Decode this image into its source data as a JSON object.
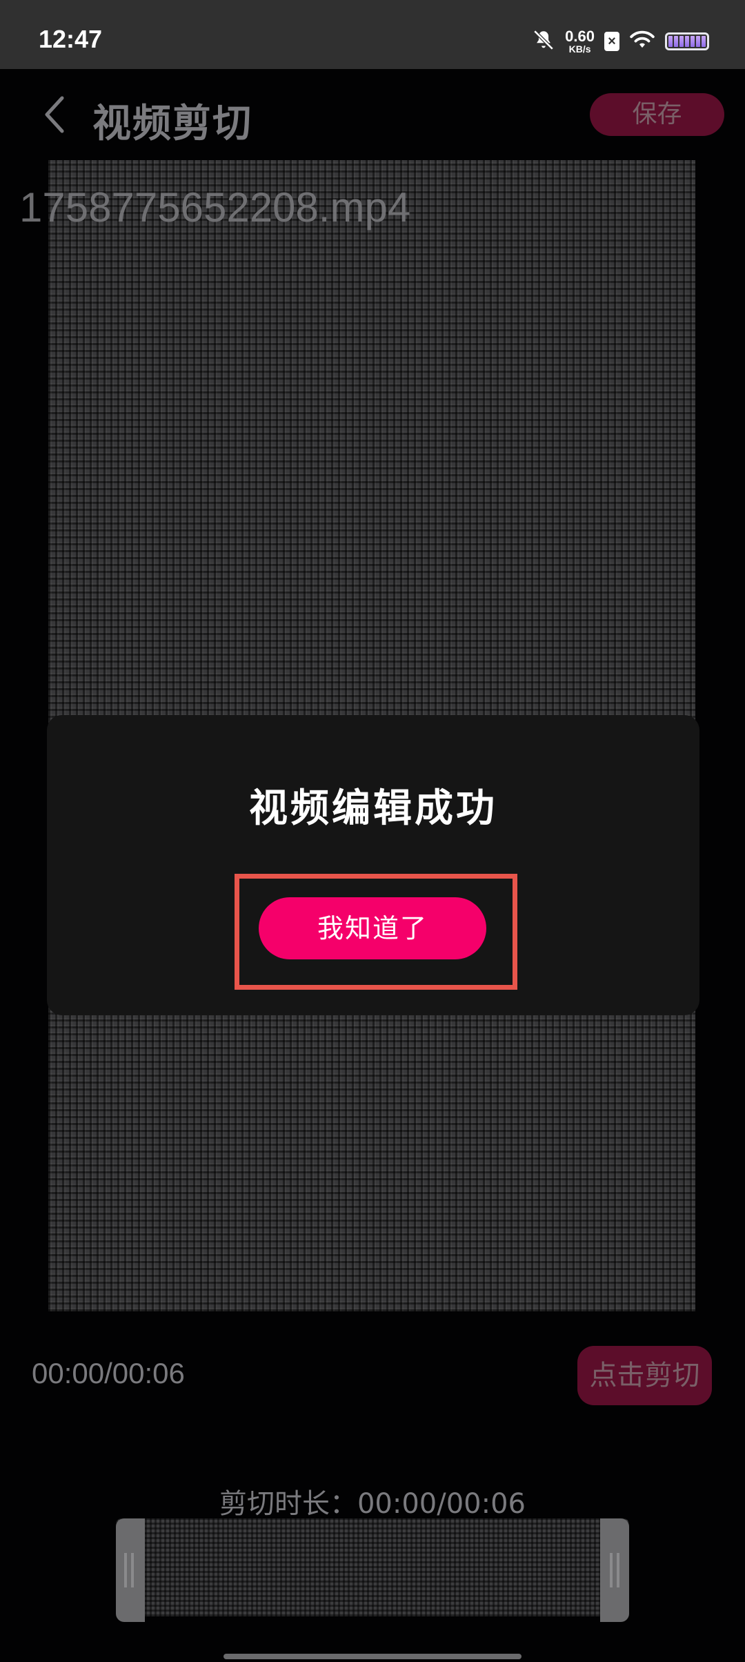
{
  "status_bar": {
    "time": "12:47",
    "net_speed_value": "0.60",
    "net_speed_unit": "KB/s",
    "icons": [
      "bell-muted-icon",
      "sim-x-icon",
      "wifi-icon",
      "battery-icon"
    ]
  },
  "header": {
    "title": "视频剪切",
    "save_label": "保存",
    "back_icon": "chevron-left-icon"
  },
  "video": {
    "file_name": "1758775652208.mp4"
  },
  "dialog": {
    "title": "视频编辑成功",
    "ok_label": "我知道了",
    "highlight_color": "#e8554b"
  },
  "player": {
    "time": "00:00/00:06",
    "cut_label": "点击剪切"
  },
  "trim": {
    "duration_label": "剪切时长：00:00/00:06"
  },
  "colors": {
    "accent": "#f5006a",
    "accent_dimmed": "#5c0d2a",
    "background": "#020203",
    "status_bar": "#303030"
  }
}
